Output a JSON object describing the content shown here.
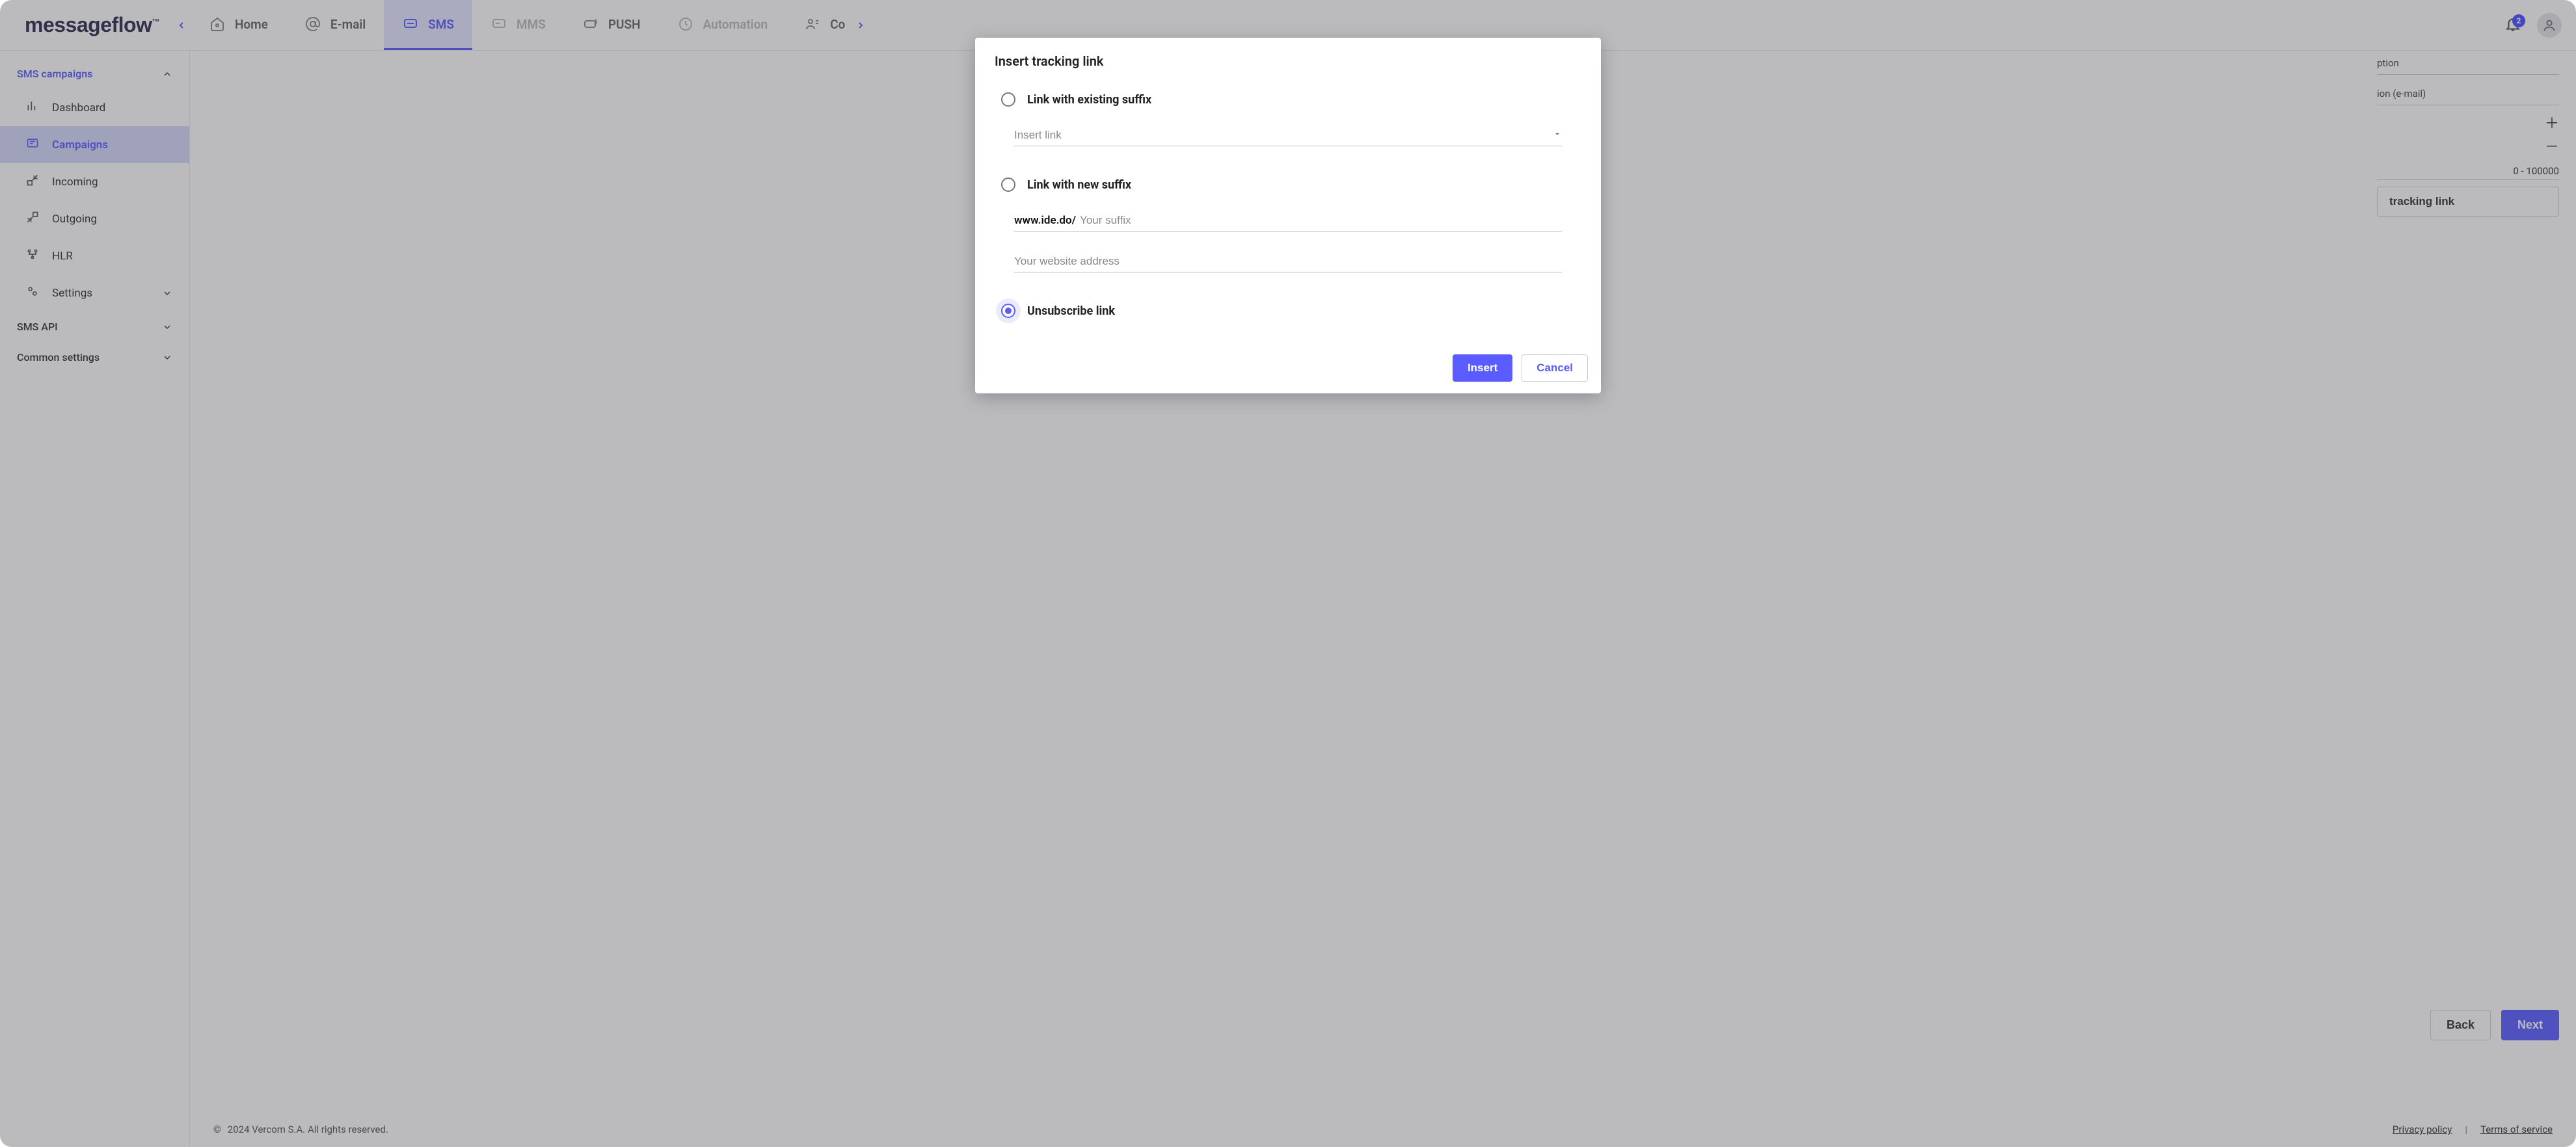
{
  "brand": {
    "name": "messageflow",
    "tm": "™"
  },
  "nav": {
    "items": [
      {
        "key": "home",
        "label": "Home"
      },
      {
        "key": "email",
        "label": "E-mail"
      },
      {
        "key": "sms",
        "label": "SMS",
        "active": true
      },
      {
        "key": "mms",
        "label": "MMS"
      },
      {
        "key": "push",
        "label": "PUSH"
      },
      {
        "key": "auto",
        "label": "Automation"
      },
      {
        "key": "co",
        "label": "Co"
      }
    ],
    "notif_count": "2"
  },
  "sidebar": {
    "group_title": "SMS campaigns",
    "items": [
      {
        "key": "dashboard",
        "label": "Dashboard"
      },
      {
        "key": "campaigns",
        "label": "Campaigns",
        "active": true
      },
      {
        "key": "incoming",
        "label": "Incoming"
      },
      {
        "key": "outgoing",
        "label": "Outgoing"
      },
      {
        "key": "hlr",
        "label": "HLR"
      },
      {
        "key": "settings",
        "label": "Settings",
        "has_chevron": true
      }
    ],
    "extra": [
      {
        "label": "SMS API"
      },
      {
        "label": "Common settings"
      }
    ]
  },
  "right_panel": {
    "line1": "ption",
    "line2": "ion (e-mail)",
    "range": "0 - 100000",
    "tracking_btn": "tracking link"
  },
  "wizard": {
    "back": "Back",
    "next": "Next"
  },
  "footer": {
    "copyright": "2024 Vercom S.A. All rights reserved.",
    "privacy": "Privacy policy",
    "terms": "Terms of service"
  },
  "modal": {
    "title": "Insert tracking link",
    "opt_existing": "Link with existing suffix",
    "existing_placeholder": "Insert link",
    "opt_new": "Link with new suffix",
    "new_prefix": "www.ide.do/",
    "new_suffix_placeholder": "Your suffix",
    "website_placeholder": "Your website address",
    "opt_unsub": "Unsubscribe link",
    "selected": "unsubscribe",
    "insert": "Insert",
    "cancel": "Cancel"
  }
}
